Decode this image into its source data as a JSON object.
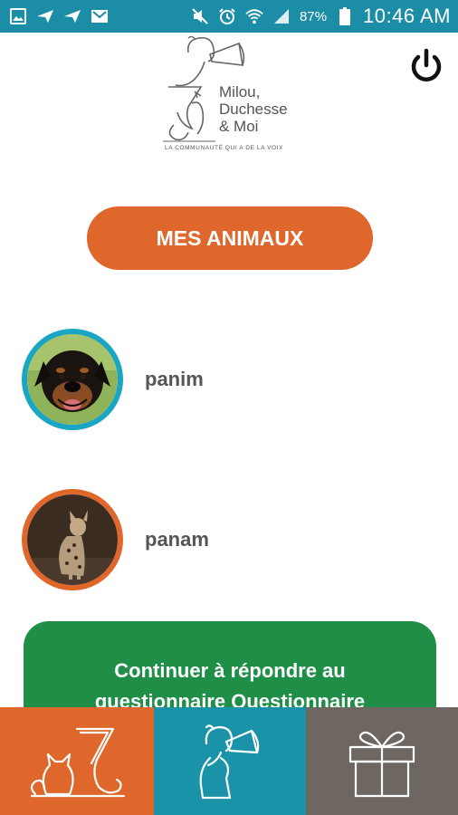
{
  "status_bar": {
    "battery_percent": "87%",
    "time": "10:46 AM",
    "icons": [
      "image-icon",
      "send-icon",
      "send-icon",
      "gmail-icon",
      "mute-icon",
      "alarm-icon",
      "wifi-icon",
      "signal-icon",
      "battery-icon"
    ]
  },
  "header": {
    "logo_text": "Milou,\nDuchesse\n& Moi",
    "logo_tagline": "LA COMMUNAUTÉ QUI A DE LA VOIX",
    "power_icon": "power-icon"
  },
  "main": {
    "pets_button_label": "MES ANIMAUX",
    "animals": [
      {
        "name": "panim",
        "species": "dog",
        "ring_color": "#1aa6c2"
      },
      {
        "name": "panam",
        "species": "cat",
        "ring_color": "#e0672b"
      }
    ],
    "quiz_card_text": "Continuer à répondre au questionnaire Questionnaire"
  },
  "tab_bar": {
    "tabs": [
      {
        "icon": "pets-icon",
        "color": "#e0672b"
      },
      {
        "icon": "megaphone-boy-icon",
        "color": "#1a93a8"
      },
      {
        "icon": "gift-icon",
        "color": "#6e6761"
      }
    ]
  },
  "colors": {
    "accent_orange": "#e0672b",
    "status_teal": "#1b8da6",
    "quiz_green": "#1f8e47"
  }
}
